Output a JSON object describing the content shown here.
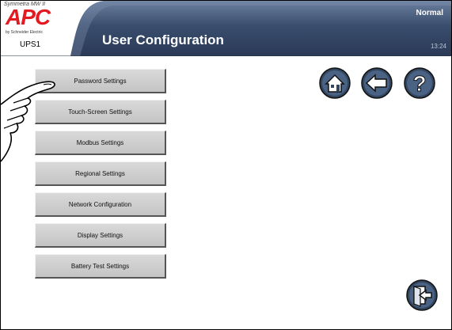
{
  "header": {
    "product_line": "Symmetra MW II",
    "brand": "APC",
    "brand_sub": "by Schneider Electric",
    "device_name": "UPS1",
    "title": "User Configuration",
    "status": "Normal",
    "time": "13:24"
  },
  "menu": {
    "items": [
      {
        "label": "Password Settings"
      },
      {
        "label": "Touch-Screen Settings"
      },
      {
        "label": "Modbus Settings"
      },
      {
        "label": "Regional Settings"
      },
      {
        "label": "Network Configuration"
      },
      {
        "label": "Display Settings"
      },
      {
        "label": "Battery Test Settings"
      }
    ]
  },
  "nav_buttons": {
    "home_icon": "home-icon",
    "back_icon": "back-arrow-icon",
    "help_icon": "help-icon",
    "help_glyph": "?",
    "exit_icon": "exit-icon"
  },
  "colors": {
    "header_band": "#2d3e5c",
    "header_band_light": "#6f82a0",
    "button_face": "#cfcfcf",
    "nav_button": "#3f5475",
    "logo_red": "#e21b23"
  }
}
